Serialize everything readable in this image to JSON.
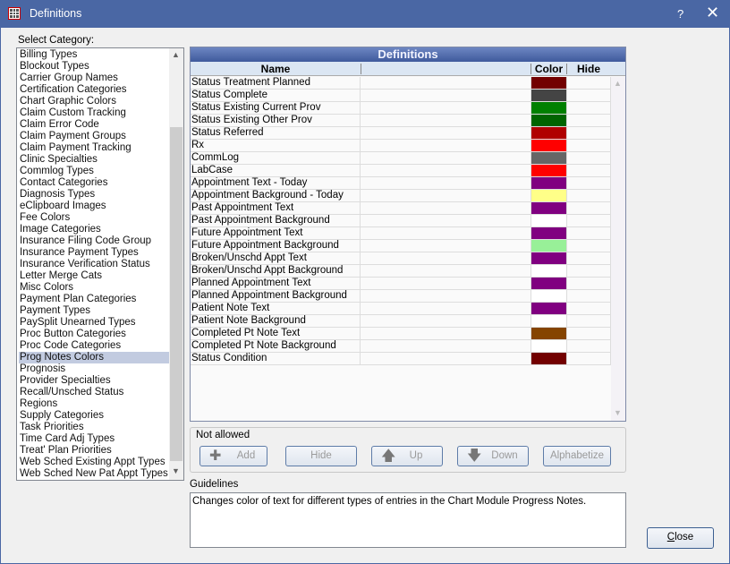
{
  "window": {
    "title": "Definitions",
    "help": "?",
    "close": "✕"
  },
  "category": {
    "label": "Select Category:",
    "selected": "Prog Notes Colors",
    "items": [
      "Billing Types",
      "Blockout Types",
      "Carrier Group Names",
      "Certification Categories",
      "Chart Graphic Colors",
      "Claim Custom Tracking",
      "Claim Error Code",
      "Claim Payment Groups",
      "Claim Payment Tracking",
      "Clinic Specialties",
      "Commlog Types",
      "Contact Categories",
      "Diagnosis Types",
      "eClipboard Images",
      "Fee Colors",
      "Image Categories",
      "Insurance Filing Code Group",
      "Insurance Payment Types",
      "Insurance Verification Status",
      "Letter Merge Cats",
      "Misc Colors",
      "Payment Plan Categories",
      "Payment Types",
      "PaySplit Unearned Types",
      "Proc Button Categories",
      "Proc Code Categories",
      "Prog Notes Colors",
      "Prognosis",
      "Provider Specialties",
      "Recall/Unsched Status",
      "Regions",
      "Supply Categories",
      "Task Priorities",
      "Time Card Adj Types",
      "Treat' Plan Priorities",
      "Web Sched Existing Appt Types",
      "Web Sched New Pat Appt Types"
    ]
  },
  "grid": {
    "title": "Definitions",
    "columns": [
      "Name",
      "",
      "Color",
      "Hide"
    ],
    "rows": [
      {
        "name": "Status Treatment Planned",
        "color": "#720000"
      },
      {
        "name": "Status Complete",
        "color": "#444444"
      },
      {
        "name": "Status Existing Current Prov",
        "color": "#008000"
      },
      {
        "name": "Status Existing Other Prov",
        "color": "#006400"
      },
      {
        "name": "Status Referred",
        "color": "#b00000"
      },
      {
        "name": "Rx",
        "color": "#ff0000"
      },
      {
        "name": "CommLog",
        "color": "#666666"
      },
      {
        "name": "LabCase",
        "color": "#ff0000"
      },
      {
        "name": "Appointment Text - Today",
        "color": "#800080"
      },
      {
        "name": "Appointment Background - Today",
        "color": "#ffff88"
      },
      {
        "name": "Past Appointment Text",
        "color": "#800080"
      },
      {
        "name": "Past Appointment Background",
        "color": "#ffffff"
      },
      {
        "name": "Future Appointment Text",
        "color": "#800080"
      },
      {
        "name": "Future Appointment Background",
        "color": "#98f098"
      },
      {
        "name": "Broken/Unschd Appt Text",
        "color": "#800080"
      },
      {
        "name": "Broken/Unschd Appt Background",
        "color": "#ffffff"
      },
      {
        "name": "Planned Appointment Text",
        "color": "#800080"
      },
      {
        "name": "Planned Appointment Background",
        "color": "#ffffff"
      },
      {
        "name": "Patient Note Text",
        "color": "#800080"
      },
      {
        "name": "Patient Note Background",
        "color": "#ffffff"
      },
      {
        "name": "Completed Pt Note Text",
        "color": "#854400"
      },
      {
        "name": "Completed Pt Note Background",
        "color": "#ffffff"
      },
      {
        "name": "Status Condition",
        "color": "#720000"
      }
    ]
  },
  "actions": {
    "group_label": "Not allowed",
    "add": "Add",
    "hide": "Hide",
    "up": "Up",
    "down": "Down",
    "alphabetize": "Alphabetize"
  },
  "guidelines": {
    "label": "Guidelines",
    "text": "Changes color of text for different types of entries in the Chart Module Progress Notes."
  },
  "close_button": "Close"
}
